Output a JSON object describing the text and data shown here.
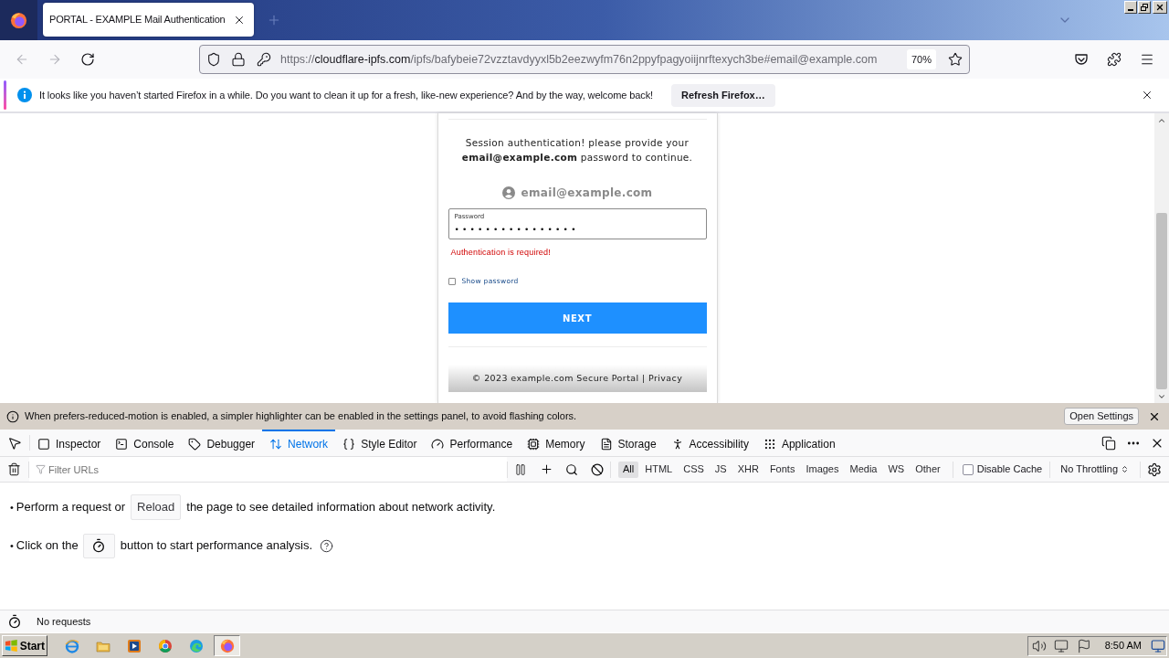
{
  "browser": {
    "tabs": [
      {
        "title": "PORTAL - EXAMPLE Mail Authentication",
        "selected": true
      }
    ],
    "back": {
      "disabled": true
    },
    "forward": {
      "disabled": true
    },
    "url": {
      "scheme": "https://",
      "host": "cloudflare-ipfs.com",
      "rest": "/ipfs/bafybeie72vzztavdyyxl5b2eezwyfm76n2ppyfpagyoiijnrftexych3be#email@example.com"
    },
    "zoom": "70%",
    "notification": {
      "message": "It looks like you haven’t started Firefox in a while. Do you want to clean it up for a fresh, like-new experience? And by the way, welcome back!",
      "button": "Refresh Firefox…"
    }
  },
  "page": {
    "intro": "Session authentication! please provide your **email@example.com** password to continue.",
    "account": "email@example.com",
    "password": {
      "label": "Password",
      "value": "••••••••••••••••"
    },
    "error": "Authentication is required!",
    "show_password": {
      "label": "Show password",
      "checked": false
    },
    "next_button": "NEXT",
    "footer": "© 2023 example.com Secure Portal | Privacy"
  },
  "devtools": {
    "notice": {
      "message": "When prefers-reduced-motion is enabled, a simpler highlighter can be enabled in the settings panel, to avoid flashing colors.",
      "button": "Open Settings"
    },
    "tabs": [
      {
        "label": "Inspector",
        "selected": false
      },
      {
        "label": "Console",
        "selected": false
      },
      {
        "label": "Debugger",
        "selected": false
      },
      {
        "label": "Network",
        "selected": true
      },
      {
        "label": "Style Editor",
        "selected": false
      },
      {
        "label": "Performance",
        "selected": false
      },
      {
        "label": "Memory",
        "selected": false
      },
      {
        "label": "Storage",
        "selected": false
      },
      {
        "label": "Accessibility",
        "selected": false
      },
      {
        "label": "Application",
        "selected": false
      }
    ],
    "network": {
      "filter": {
        "placeholder": "Filter URLs"
      },
      "types": [
        {
          "label": "All",
          "selected": true
        },
        {
          "label": "HTML",
          "selected": false
        },
        {
          "label": "CSS",
          "selected": false
        },
        {
          "label": "JS",
          "selected": false
        },
        {
          "label": "XHR",
          "selected": false
        },
        {
          "label": "Fonts",
          "selected": false
        },
        {
          "label": "Images",
          "selected": false
        },
        {
          "label": "Media",
          "selected": false
        },
        {
          "label": "WS",
          "selected": false
        },
        {
          "label": "Other",
          "selected": false
        }
      ],
      "disable_cache": {
        "label": "Disable Cache",
        "checked": false
      },
      "throttling": "No Throttling",
      "hints": [
        {
          "kind": "text",
          "bullet": "•",
          "before": "Perform a request or",
          "button": "Reload",
          "after": "the page to see detailed information about network activity."
        },
        {
          "kind": "icon",
          "bullet": "•",
          "before": "Click on the",
          "after": "button to start performance analysis."
        }
      ],
      "status": "No requests"
    }
  },
  "taskbar": {
    "start": "Start",
    "tasks": [
      {
        "active": true
      }
    ],
    "clock": "8:50 AM"
  }
}
